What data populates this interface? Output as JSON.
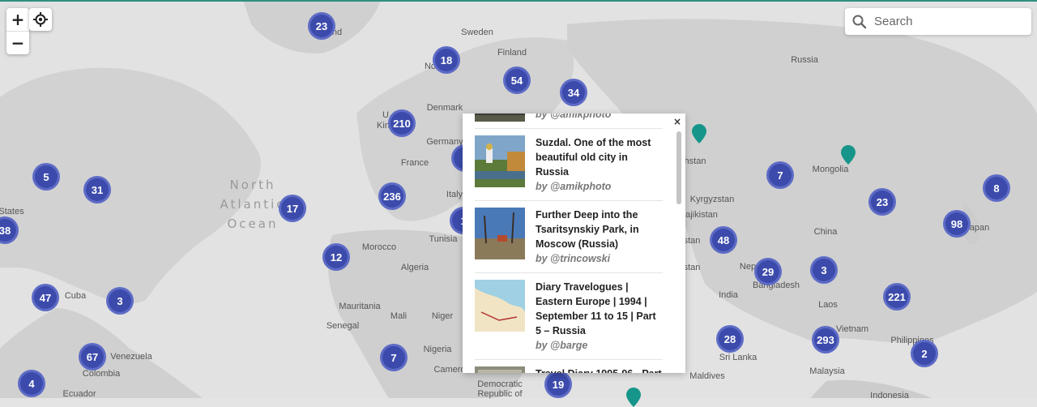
{
  "map": {
    "labels": {
      "sweden": "Sweden",
      "finland": "Finland",
      "russia": "Russia",
      "denmark": "Denmark",
      "germany": "Germany",
      "france": "France",
      "italy": "Italy",
      "tunisia": "Tunisia",
      "morocco": "Morocco",
      "algeria": "Algeria",
      "mauritania": "Mauritania",
      "mali": "Mali",
      "niger": "Niger",
      "senegal": "Senegal",
      "nigeria": "Nigeria",
      "cameroon": "Camero",
      "drc_line1": "Democratic",
      "drc_line2": "Republic of",
      "states": "States",
      "cuba": "Cuba",
      "venezuela": "Venezuela",
      "colombia": "Colombia",
      "ecuador": "Ecuador",
      "kyrgyzstan": "Kyrgyzstan",
      "tajikistan": "ajikistan",
      "kazakhstan_frag": "hstan",
      "afghanistan_frag": "stan",
      "pakistan_frag": "stan",
      "mongolia": "Mongolia",
      "china": "China",
      "japan": "apan",
      "nepal": "Nep",
      "bangladesh": "Bangladesh",
      "india": "India",
      "laos": "Laos",
      "vietnam": "Vietnam",
      "philippines": "Philippines",
      "sri_lanka": "Sri Lanka",
      "maldives": "Maldives",
      "malaysia": "Malaysia",
      "indonesia": "Indonesia",
      "iceland_frag": "nd",
      "norway_frag": "No",
      "uk_frag1": "U",
      "uk_frag2": "Kin"
    },
    "ocean": {
      "line1": "North",
      "line2": "Atlantic",
      "line3": "Ocean"
    },
    "clusters": [
      "23",
      "18",
      "54",
      "34",
      "210",
      "5",
      "31",
      "236",
      "17",
      "38",
      "12",
      "47",
      "3",
      "67",
      "4",
      "7",
      "19",
      "7",
      "23",
      "8",
      "98",
      "48",
      "29",
      "3",
      "221",
      "28",
      "293",
      "2",
      "3",
      "1"
    ],
    "pin_color": "#16968a",
    "cluster_color": "#3c4bab"
  },
  "controls": {
    "zoom_in": "+",
    "zoom_out": "−",
    "locate": "locate-icon"
  },
  "search": {
    "placeholder": "Search"
  },
  "popup": {
    "close": "×",
    "posts": [
      {
        "title": "",
        "author": "by @amikphoto"
      },
      {
        "title": "Suzdal. One of the most beautiful old city in Russia",
        "author": "by @amikphoto"
      },
      {
        "title": "Further Deep into the Tsaritsynskiy Park, in Moscow (Russia)",
        "author": "by @trincowski"
      },
      {
        "title": "Diary Travelogues | Eastern Europe | 1994 | September 11 to 15 | Part 5 – Russia",
        "author": "by @barge"
      },
      {
        "title": "Travel Diary 1995-96 - Part",
        "author": ""
      }
    ]
  }
}
